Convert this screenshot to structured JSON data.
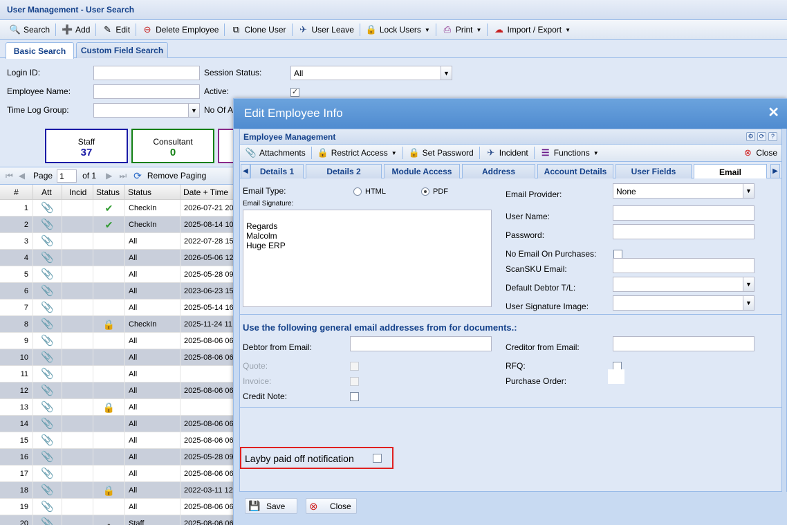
{
  "window": {
    "title": "User Management - User Search"
  },
  "toolbar": {
    "items": [
      "Search",
      "Add",
      "Edit",
      "Delete Employee",
      "Clone User",
      "User Leave",
      "Lock Users",
      "Print",
      "Import / Export"
    ]
  },
  "tabs": [
    "Basic Search",
    "Custom Field Search"
  ],
  "search": {
    "login_label": "Login ID:",
    "employee_name_label": "Employee Name:",
    "time_log_label": "Time Log Group:",
    "session_label": "Session Status:",
    "session_value": "All",
    "active_label": "Active:",
    "no_of_label": "No Of A"
  },
  "counters": [
    {
      "label": "Staff",
      "count": "37",
      "color": "#1a1aa6"
    },
    {
      "label": "Consultant",
      "count": "0",
      "color": "#138013"
    }
  ],
  "pager": {
    "page_label": "Page",
    "page_value": "1",
    "of_label": "of 1",
    "remove_paging": "Remove Paging"
  },
  "grid": {
    "columns": [
      "#",
      "Att",
      "Incid",
      "Status",
      "Status",
      "Date + Time"
    ],
    "rows": [
      {
        "n": "1",
        "att": "grey",
        "status_icon": "check",
        "status": "CheckIn",
        "date": "2026-07-21 20"
      },
      {
        "n": "2",
        "att": "grey",
        "status_icon": "check",
        "status": "CheckIn",
        "date": "2025-08-14 10"
      },
      {
        "n": "3",
        "att": "grey",
        "status_icon": "",
        "status": "All",
        "date": "2022-07-28 15"
      },
      {
        "n": "4",
        "att": "grey",
        "status_icon": "",
        "status": "All",
        "date": "2026-05-06 12"
      },
      {
        "n": "5",
        "att": "grey",
        "status_icon": "",
        "status": "All",
        "date": "2025-05-28 09"
      },
      {
        "n": "6",
        "att": "grey",
        "status_icon": "",
        "status": "All",
        "date": "2023-06-23 15"
      },
      {
        "n": "7",
        "att": "grey",
        "status_icon": "",
        "status": "All",
        "date": "2025-05-14 16"
      },
      {
        "n": "8",
        "att": "red",
        "status_icon": "lock",
        "status": "CheckIn",
        "date": "2025-11-24 11"
      },
      {
        "n": "9",
        "att": "red",
        "status_icon": "",
        "status": "All",
        "date": "2025-08-06 06"
      },
      {
        "n": "10",
        "att": "grey",
        "status_icon": "",
        "status": "All",
        "date": "2025-08-06 06"
      },
      {
        "n": "11",
        "att": "grey",
        "status_icon": "",
        "status": "All",
        "date": ""
      },
      {
        "n": "12",
        "att": "grey",
        "status_icon": "",
        "status": "All",
        "date": "2025-08-06 06"
      },
      {
        "n": "13",
        "att": "red",
        "status_icon": "lock",
        "status": "All",
        "date": ""
      },
      {
        "n": "14",
        "att": "grey",
        "status_icon": "",
        "status": "All",
        "date": "2025-08-06 06"
      },
      {
        "n": "15",
        "att": "grey",
        "status_icon": "",
        "status": "All",
        "date": "2025-08-06 06"
      },
      {
        "n": "16",
        "att": "grey",
        "status_icon": "",
        "status": "All",
        "date": "2025-05-28 09"
      },
      {
        "n": "17",
        "att": "grey",
        "status_icon": "",
        "status": "All",
        "date": "2025-08-06 06"
      },
      {
        "n": "18",
        "att": "grey",
        "status_icon": "lock",
        "status": "All",
        "date": "2022-03-11 12"
      },
      {
        "n": "19",
        "att": "grey",
        "status_icon": "",
        "status": "All",
        "date": "2025-08-06 06"
      },
      {
        "n": "20",
        "att": "grey",
        "status_icon": "pin",
        "status": "Staff",
        "date": "2025-08-06 06"
      }
    ]
  },
  "dialog": {
    "title": "Edit Employee Info",
    "panel_title": "Employee Management",
    "toolbar": [
      "Attachments",
      "Restrict Access",
      "Set Password",
      "Incident",
      "Functions",
      "Close"
    ],
    "tabs": [
      "Details 1",
      "Details 2",
      "Module Access",
      "Address",
      "Account Details",
      "User Fields",
      "Email"
    ],
    "email": {
      "type_label": "Email Type:",
      "html_label": "HTML",
      "pdf_label": "PDF",
      "signature_label": "Email Signature:",
      "signature_lines": [
        "Regards",
        "Malcolm",
        "Huge ERP"
      ],
      "provider_label": "Email Provider:",
      "provider_value": "None",
      "user_name_label": "User Name:",
      "password_label": "Password:",
      "no_email_label": "No Email On Purchases:",
      "scansku_label": "ScanSKU Email:",
      "default_debtor_label": "Default Debtor T/L:",
      "signature_image_label": "User Signature Image:",
      "section_title": "Use the following general email addresses from for documents.:",
      "debtor_from_label": "Debtor from Email:",
      "creditor_from_label": "Creditor from Email:",
      "quote_label": "Quote:",
      "invoice_label": "Invoice:",
      "credit_note_label": "Credit Note:",
      "rfq_label": "RFQ:",
      "purchase_order_label": "Purchase Order:",
      "layby_label": "Layby paid off notification"
    },
    "footer": {
      "save": "Save",
      "close": "Close"
    }
  }
}
